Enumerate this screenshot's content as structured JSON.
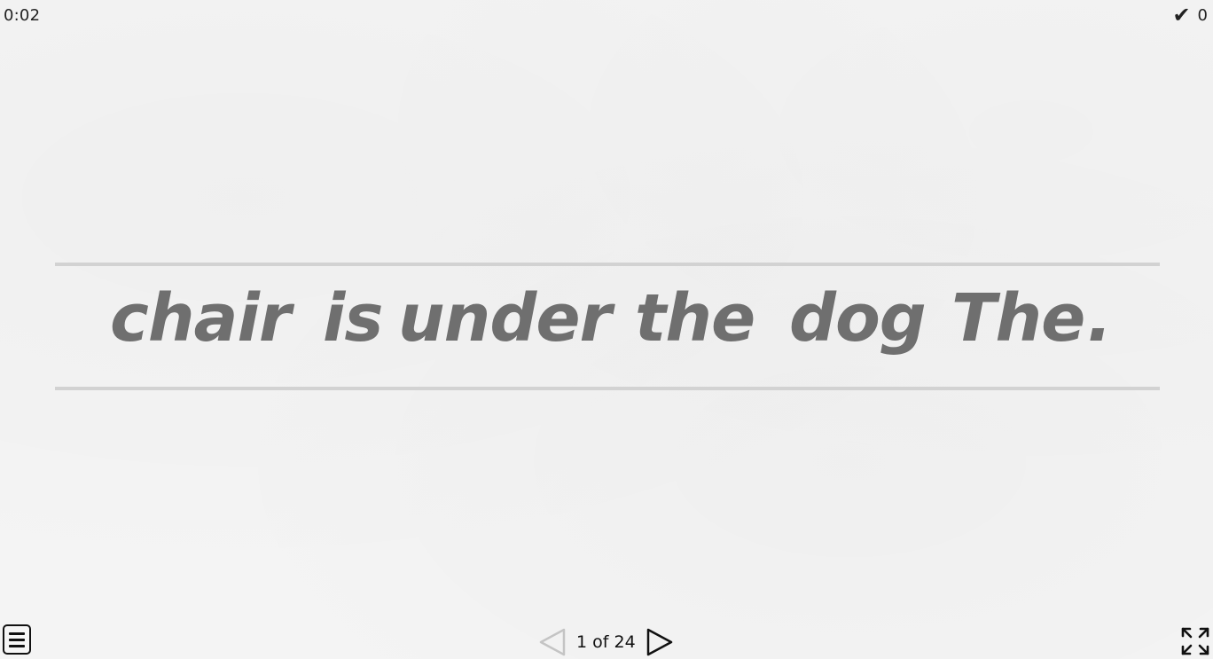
{
  "timer": {
    "elapsed": "0:02"
  },
  "score": {
    "icon": "check-icon",
    "value": "0"
  },
  "sentence": {
    "words": [
      "chair",
      "is",
      "under",
      "the",
      "dog",
      "The",
      "."
    ]
  },
  "pager": {
    "label": "1 of 24",
    "prev_icon": "prev-triangle-icon",
    "next_icon": "next-triangle-icon"
  },
  "controls": {
    "menu_icon": "menu-icon",
    "fullscreen_icon": "fullscreen-icon"
  }
}
